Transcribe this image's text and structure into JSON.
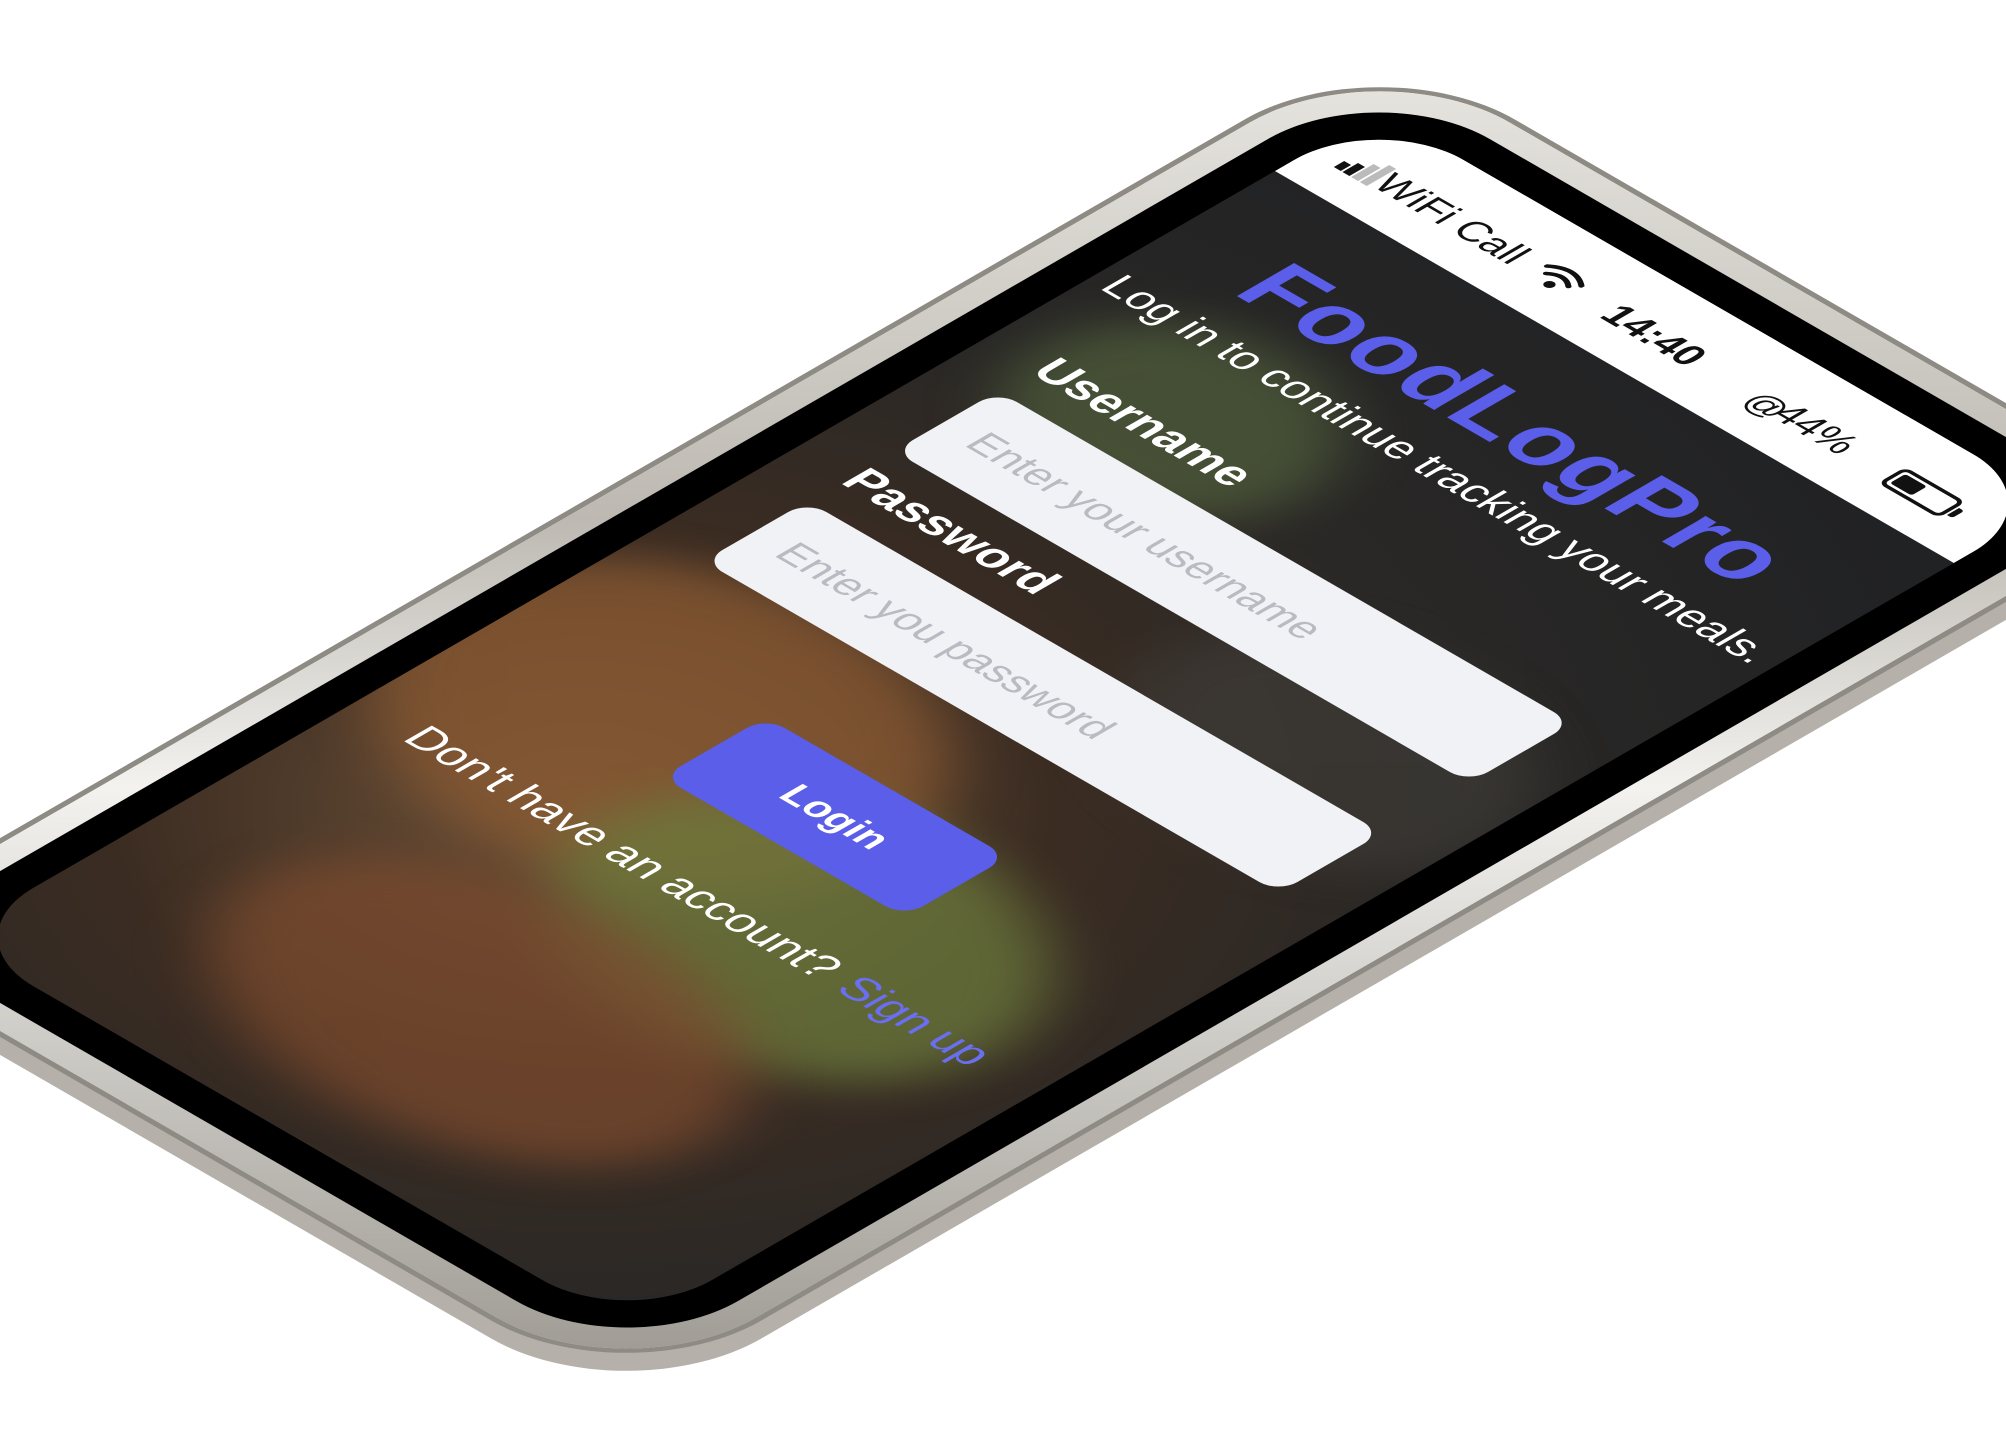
{
  "status_bar": {
    "carrier": "WiFi Call",
    "time": "14:40",
    "battery_percent_text": "44%",
    "battery_level": 0.44,
    "icons": [
      "signal-bars-icon",
      "wifi-icon",
      "location-icon",
      "battery-icon"
    ]
  },
  "app": {
    "title": "FoodLogPro",
    "subtitle": "Log in to continue tracking your meals.",
    "accent_color": "#5a5ee8"
  },
  "form": {
    "username_label": "Username",
    "username_placeholder": "Enter your username",
    "password_label": "Password",
    "password_placeholder": "Enter you password",
    "login_label": "Login"
  },
  "footer": {
    "prompt": "Don't have an account?",
    "signup_label": "Sign up"
  }
}
